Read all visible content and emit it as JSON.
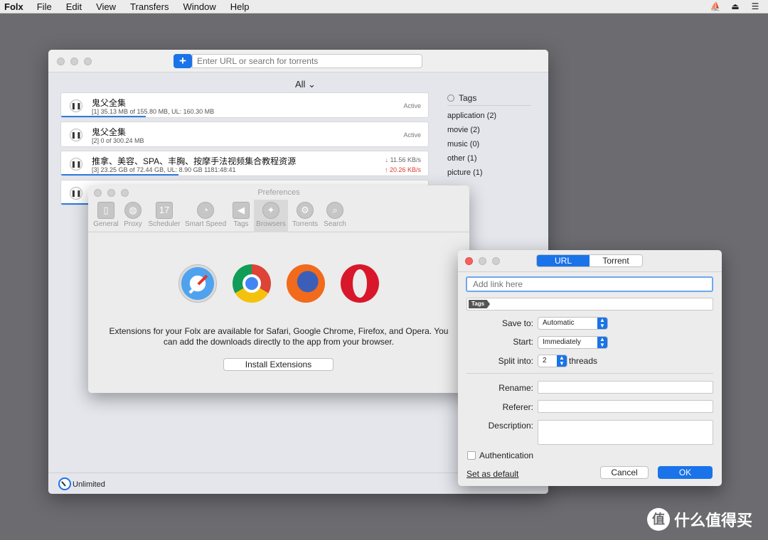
{
  "menubar": {
    "app": "Folx",
    "items": [
      "File",
      "Edit",
      "View",
      "Transfers",
      "Window",
      "Help"
    ]
  },
  "main": {
    "search_placeholder": "Enter URL or search for torrents",
    "plus": "+",
    "filter": "All ⌄",
    "downloads": [
      {
        "name": "鬼父全集",
        "info": "[1] 35.13 MB of 155.80 MB, UL: 160.30 MB",
        "status": "Active",
        "progress": 0.23
      },
      {
        "name": "鬼父全集",
        "info": "[2] 0 of 300.24 MB",
        "status": "Active",
        "progress": 0.0
      },
      {
        "name": "推拿、美容、SPA、丰胸、按摩手法视频集合教程资源",
        "info": "[3] 23.25 GB of 72.44 GB, UL: 8.90 GB 1181:48:41",
        "down": "↓ 11.56 KB/s",
        "up": "↑ 20.26 KB/s",
        "progress": 0.32
      },
      {
        "name": "",
        "info": "",
        "status": "",
        "progress": 0.08
      }
    ],
    "tags_header": "Tags",
    "tags": [
      "application (2)",
      "movie (2)",
      "music (0)",
      "other (1)",
      "picture (1)"
    ],
    "speed_limit": "Unlimited"
  },
  "prefs": {
    "title": "Preferences",
    "tabs": [
      {
        "label": "General",
        "icon": "general-icon",
        "glyph": "▯"
      },
      {
        "label": "Proxy",
        "icon": "globe-icon",
        "glyph": "◍"
      },
      {
        "label": "Scheduler",
        "icon": "calendar-icon",
        "glyph": "17"
      },
      {
        "label": "Smart Speed",
        "icon": "gauge-icon",
        "glyph": "◔"
      },
      {
        "label": "Tags",
        "icon": "tag-icon",
        "glyph": "◀"
      },
      {
        "label": "Browsers",
        "icon": "compass-icon",
        "glyph": "✦"
      },
      {
        "label": "Torrents",
        "icon": "gear-icon",
        "glyph": "⚙"
      },
      {
        "label": "Search",
        "icon": "magnifier-icon",
        "glyph": "⌕"
      }
    ],
    "selected_tab": "Browsers",
    "extensions_text": "Extensions for your Folx are available for Safari, Google Chrome, Firefox, and Opera. You can add the downloads directly to the app from your browser.",
    "install_button": "Install Extensions"
  },
  "dialog": {
    "segment_url": "URL",
    "segment_torrent": "Torrent",
    "link_placeholder": "Add link here",
    "tags_chip": "Tags",
    "save_to_label": "Save to:",
    "save_to_value": "Automatic",
    "start_label": "Start:",
    "start_value": "Immediately",
    "split_label": "Split into:",
    "split_value": "2",
    "threads_label": "threads",
    "rename_label": "Rename:",
    "referer_label": "Referer:",
    "description_label": "Description:",
    "auth_label": "Authentication",
    "set_default": "Set as default",
    "cancel": "Cancel",
    "ok": "OK"
  },
  "watermark": {
    "glyph": "值",
    "text": "什么值得买"
  }
}
